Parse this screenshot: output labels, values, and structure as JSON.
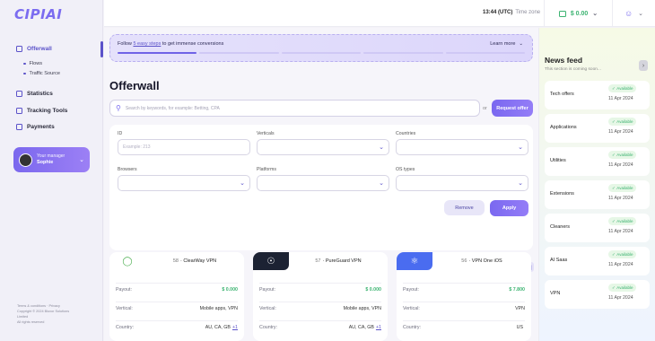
{
  "app": {
    "logo": "CIPIAI"
  },
  "topbar": {
    "time": "13:44 (UTC)",
    "time_label": "Time zone",
    "balance": "$ 0.00"
  },
  "sidebar": {
    "items": [
      {
        "label": "Offerwall"
      },
      {
        "label": "Statistics"
      },
      {
        "label": "Tracking Tools"
      },
      {
        "label": "Payments"
      }
    ],
    "subitems": [
      {
        "label": "Flows"
      },
      {
        "label": "Traffic Source"
      }
    ],
    "manager": {
      "title": "Your manager",
      "name": "Sophie"
    },
    "footer": [
      "Terms & conditions  ·  Privacy",
      "Copyright © 2024 Bluxor Solutions",
      "Limited",
      "All rights reserved"
    ]
  },
  "banner": {
    "prefix": "Follow",
    "link": "5 easy steps",
    "suffix": "to get immense conversions",
    "learn_more": "Learn more",
    "progress": 0.2
  },
  "page": {
    "title": "Offerwall"
  },
  "search": {
    "placeholder": "Search by keywords, for example: Betting, CPA",
    "or": "or",
    "request_label": "Request offer"
  },
  "filters": {
    "id_label": "ID",
    "id_placeholder": "Example: 213",
    "verticals_label": "Verticals",
    "countries_label": "Countries",
    "browsers_label": "Browsers",
    "platforms_label": "Platforms",
    "os_label": "OS types",
    "remove_label": "Remove",
    "apply_label": "Apply"
  },
  "offers": [
    {
      "id": "58",
      "name": "ClearWay VPN",
      "payout": "$ 0.000",
      "vertical": "Mobile apps, VPN",
      "country": "AU, CA, GB",
      "more": "+1",
      "logo_bg": "#ffffff",
      "logo_icon": "shield-icon"
    },
    {
      "id": "57",
      "name": "PureGuard VPN",
      "payout": "$ 0.000",
      "vertical": "Mobile apps, VPN",
      "country": "AU, CA, GB",
      "more": "+1",
      "logo_bg": "#1c2233",
      "logo_icon": "guard-icon"
    },
    {
      "id": "56",
      "name": "VPN One iOS",
      "payout": "$ 7.800",
      "vertical": "VPN",
      "country": "US",
      "more": "",
      "logo_bg": "#4a6cf0",
      "logo_icon": "lock-icon"
    }
  ],
  "offer_labels": {
    "payout": "Payout:",
    "vertical": "Vertical:",
    "country": "Country:"
  },
  "news": {
    "title": "News feed",
    "subtitle": "This section is coming soon...",
    "items": [
      {
        "title": "Tech offers",
        "status": "Available",
        "date": "11 Apr 2024"
      },
      {
        "title": "Applications",
        "status": "Available",
        "date": "11 Apr 2024"
      },
      {
        "title": "Utilities",
        "status": "Available",
        "date": "11 Apr 2024"
      },
      {
        "title": "Extensions",
        "status": "Available",
        "date": "11 Apr 2024"
      },
      {
        "title": "Cleaners",
        "status": "Available",
        "date": "11 Apr 2024"
      },
      {
        "title": "AI Saas",
        "status": "Available",
        "date": "11 Apr 2024"
      },
      {
        "title": "VPN",
        "status": "Available",
        "date": "11 Apr 2024"
      }
    ]
  }
}
